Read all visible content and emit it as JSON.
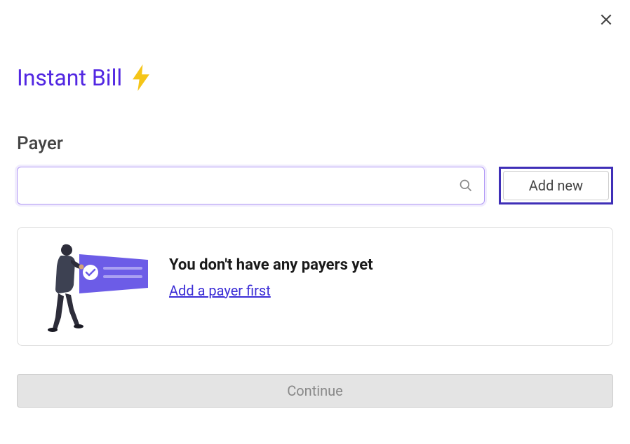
{
  "modal": {
    "title": "Instant Bill",
    "close_icon": "close"
  },
  "payer_section": {
    "label": "Payer",
    "search_value": "",
    "search_placeholder": "",
    "add_new_label": "Add new"
  },
  "empty_state": {
    "title": "You don't have any payers yet",
    "link_text": "Add a payer first"
  },
  "actions": {
    "continue_label": "Continue"
  }
}
